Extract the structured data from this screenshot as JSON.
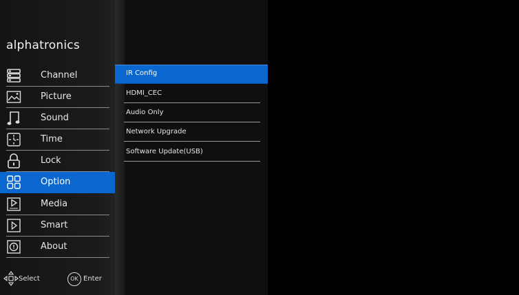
{
  "brand": "alphatronics",
  "menu": [
    {
      "label": "Channel",
      "icon": "channel-icon",
      "selected": false
    },
    {
      "label": "Picture",
      "icon": "picture-icon",
      "selected": false
    },
    {
      "label": "Sound",
      "icon": "sound-icon",
      "selected": false
    },
    {
      "label": "Time",
      "icon": "time-icon",
      "selected": false
    },
    {
      "label": "Lock",
      "icon": "lock-icon",
      "selected": false
    },
    {
      "label": "Option",
      "icon": "option-icon",
      "selected": true
    },
    {
      "label": "Media",
      "icon": "media-icon",
      "selected": false
    },
    {
      "label": "Smart",
      "icon": "smart-icon",
      "selected": false
    },
    {
      "label": "About",
      "icon": "about-icon",
      "selected": false
    }
  ],
  "submenu": [
    {
      "label": "IR Config",
      "selected": true
    },
    {
      "label": "HDMI_CEC",
      "selected": false
    },
    {
      "label": "Audio Only",
      "selected": false
    },
    {
      "label": "Network Upgrade",
      "selected": false
    },
    {
      "label": "Software Update(USB)",
      "selected": false
    }
  ],
  "hints": {
    "select_label": "Select",
    "ok_icon_text": "OK",
    "enter_label": "Enter"
  },
  "colors": {
    "accent": "#0b67d0",
    "background": "#000000",
    "sidebar": "#1b1b1b"
  }
}
